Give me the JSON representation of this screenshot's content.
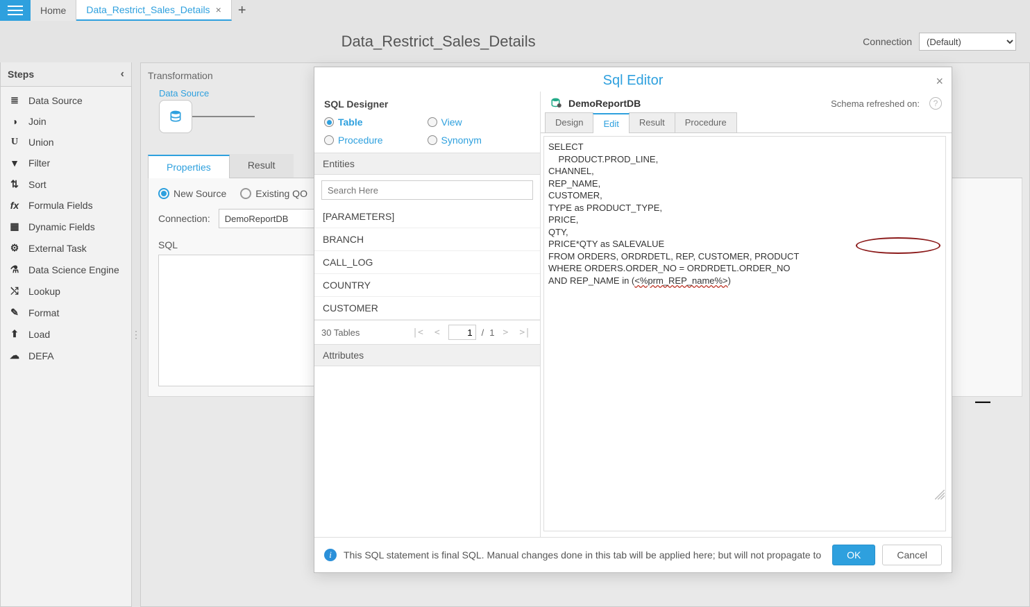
{
  "tabs": {
    "home": "Home",
    "active": "Data_Restrict_Sales_Details"
  },
  "header": {
    "title": "Data_Restrict_Sales_Details",
    "connection_label": "Connection",
    "connection_value": "(Default)"
  },
  "steps": {
    "title": "Steps",
    "items": [
      "Data Source",
      "Join",
      "Union",
      "Filter",
      "Sort",
      "Formula Fields",
      "Dynamic Fields",
      "External Task",
      "Data Science Engine",
      "Lookup",
      "Format",
      "Load",
      "DEFA"
    ]
  },
  "transform": {
    "title": "Transformation",
    "node_title": "Data Source"
  },
  "properties": {
    "tabs": {
      "properties": "Properties",
      "result": "Result"
    },
    "source": {
      "new": "New Source",
      "existing": "Existing QO"
    },
    "connection_label": "Connection:",
    "connection_value": "DemoReportDB",
    "sql_label": "SQL"
  },
  "modal": {
    "title": "Sql Editor",
    "close": "×",
    "designer": {
      "title": "SQL Designer",
      "types": {
        "table": "Table",
        "view": "View",
        "procedure": "Procedure",
        "synonym": "Synonym"
      },
      "entities_label": "Entities",
      "search_placeholder": "Search Here",
      "entities": [
        "[PARAMETERS]",
        "BRANCH",
        "CALL_LOG",
        "COUNTRY",
        "CUSTOMER"
      ],
      "pager": {
        "count": "30 Tables",
        "page": "1",
        "total": "1"
      },
      "attributes_label": "Attributes"
    },
    "editor": {
      "db": "DemoReportDB",
      "schema_label": "Schema refreshed on:",
      "tabs": {
        "design": "Design",
        "edit": "Edit",
        "result": "Result",
        "procedure": "Procedure"
      },
      "sql": "SELECT\n    PRODUCT.PROD_LINE,\nCHANNEL,\nREP_NAME,\nCUSTOMER,\nTYPE as PRODUCT_TYPE,\nPRICE,\nQTY,\nPRICE*QTY as SALEVALUE\nFROM ORDERS, ORDRDETL, REP, CUSTOMER, PRODUCT\nWHERE ORDERS.ORDER_NO = ORDRDETL.ORDER_NO\nAND REP_NAME in (<%prm_REP_name%>)"
    },
    "footer": {
      "info": "This SQL statement is final SQL. Manual changes done in this tab will be applied here; but will not propagate to",
      "ok": "OK",
      "cancel": "Cancel"
    }
  }
}
